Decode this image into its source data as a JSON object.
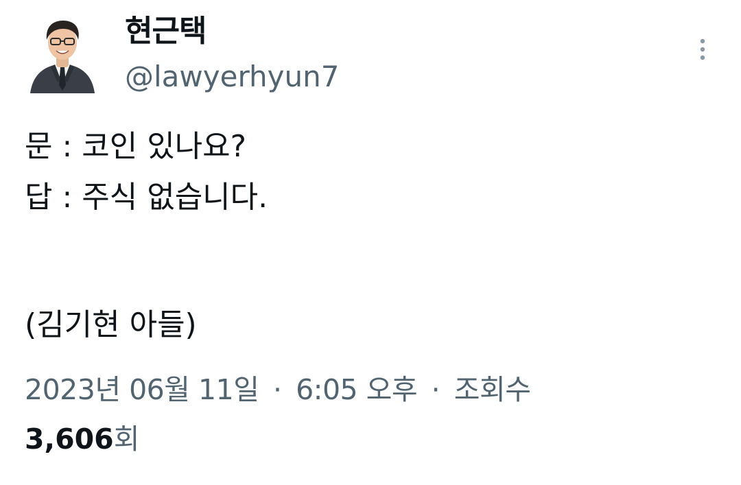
{
  "author": {
    "display_name": "현근택",
    "handle": "@lawyerhyun7"
  },
  "tweet": {
    "lines": [
      "문 : 코인 있나요?",
      "답 : 주식 없습니다.",
      "(김기현 아들)"
    ]
  },
  "meta": {
    "date": "2023년 06월 11일",
    "time": "6:05 오후",
    "views_label": "조회수",
    "separator": "·",
    "views_count": "3,606",
    "views_unit": "회"
  },
  "icons": {
    "more": "more-vertical-icon",
    "avatar": "avatar"
  },
  "colors": {
    "text_primary": "#0f1419",
    "text_secondary": "#536471"
  }
}
